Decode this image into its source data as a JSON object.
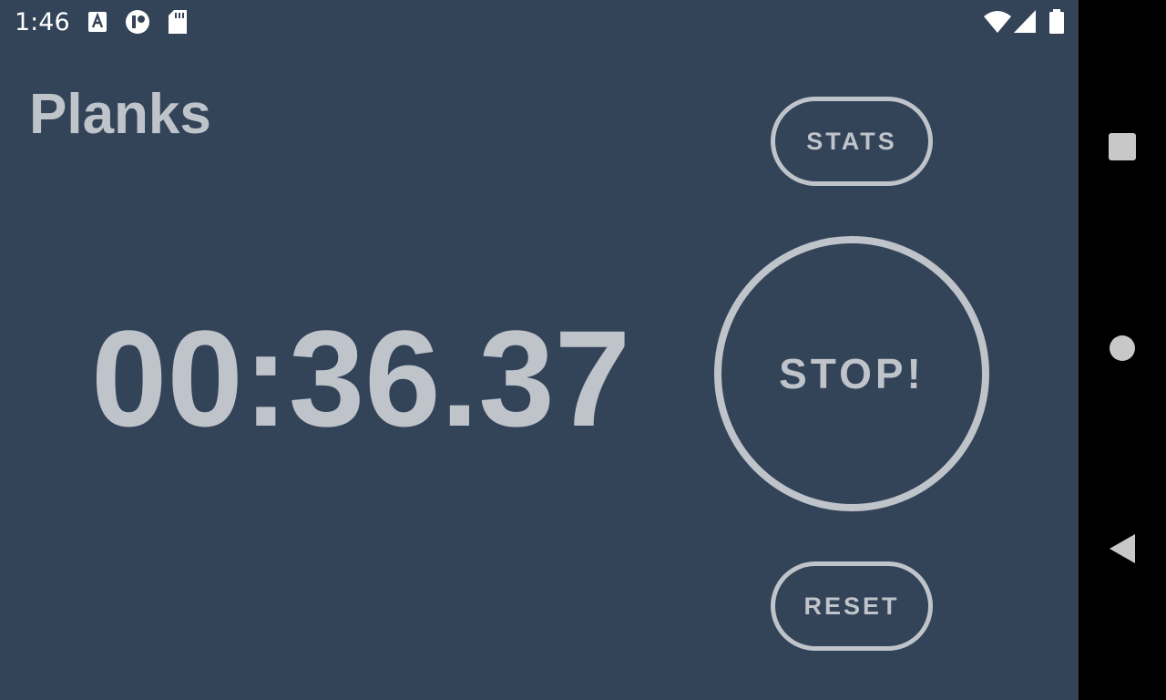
{
  "status_bar": {
    "time": "1:46",
    "left_icons": [
      "font-notification-icon",
      "app-notification-icon",
      "sd-card-icon"
    ],
    "right_icons": [
      "wifi-icon",
      "signal-icon",
      "battery-icon"
    ]
  },
  "app": {
    "title": "Planks",
    "timer": "00:36.37",
    "buttons": {
      "stats": "STATS",
      "stop": "STOP!",
      "reset": "RESET"
    }
  },
  "nav_bar": {
    "icons": [
      "recents-icon",
      "home-icon",
      "back-icon"
    ]
  },
  "colors": {
    "background": "#334358",
    "foreground": "#bfc3ca",
    "status_text": "#ffffff",
    "nav_background": "#000000",
    "nav_icon": "#c8c8c8"
  }
}
